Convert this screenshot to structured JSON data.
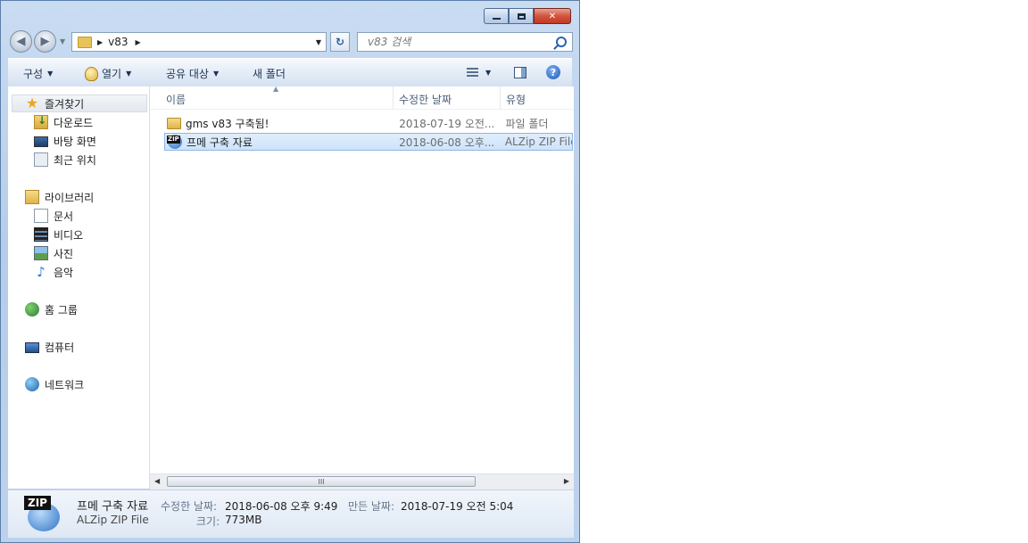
{
  "window": {
    "controls": {
      "minimize": "",
      "maximize": "",
      "close": "✕"
    }
  },
  "nav": {
    "back_glyph": "◀",
    "forward_glyph": "▶",
    "address_path": [
      "v83"
    ],
    "search_placeholder": "v83 검색"
  },
  "toolbar": {
    "organize": "구성",
    "open": "열기",
    "share": "공유 대상",
    "new_folder": "새 폴더",
    "help": "?"
  },
  "sidebar": {
    "favorites": {
      "label": "즐겨찾기",
      "items": [
        "다운로드",
        "바탕 화면",
        "최근 위치"
      ]
    },
    "libraries": {
      "label": "라이브러리",
      "items": [
        "문서",
        "비디오",
        "사진",
        "음악"
      ]
    },
    "homegroup": "홈 그룹",
    "computer": "컴퓨터",
    "network": "네트워크"
  },
  "columns": {
    "name": "이름",
    "date": "수정한 날짜",
    "type": "유형"
  },
  "files": [
    {
      "name": "gms v83 구축됨!",
      "date": "2018-07-19 오전...",
      "type": "파일 폴더",
      "icon": "folder-icon"
    },
    {
      "name": "프메 구축 자료",
      "date": "2018-06-08 오후...",
      "type": "ALZip ZIP File",
      "icon": "zip-icon"
    }
  ],
  "scrollbar": {
    "thumb_grip": "III"
  },
  "details": {
    "icon_tag": "ZIP",
    "name": "프메 구축 자료",
    "type": "ALZip ZIP File",
    "modified_label": "수정한 날짜:",
    "modified_value": "2018-06-08 오후 9:49",
    "created_label": "만든 날짜:",
    "created_value": "2018-07-19 오전 5:04",
    "size_label": "크기:",
    "size_value": "773MB"
  },
  "colors": {
    "selection": "#cde3fb",
    "window_frame": "#b6cde9",
    "close_button": "#c23a24"
  }
}
